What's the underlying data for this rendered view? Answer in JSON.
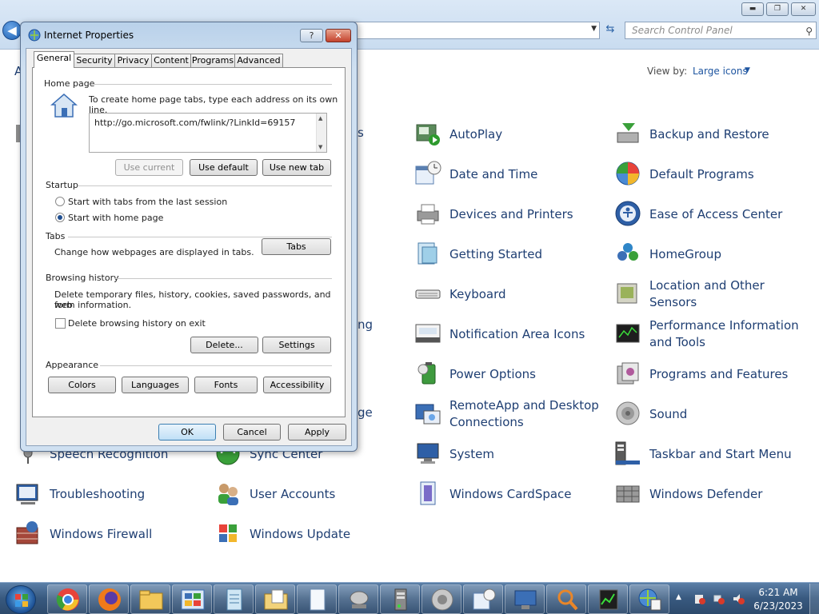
{
  "control_panel": {
    "search_placeholder": "Search Control Panel",
    "adjust_heading": "A",
    "view_by_label": "View by:",
    "view_by_value": "Large icons",
    "items": [
      {
        "label": "AutoPlay",
        "icon": "autoplay-icon"
      },
      {
        "label": "Backup and Restore",
        "icon": "backup-icon"
      },
      {
        "label": "Date and Time",
        "icon": "calendar-clock-icon"
      },
      {
        "label": "Default Programs",
        "icon": "default-programs-icon"
      },
      {
        "label": "Devices and Printers",
        "icon": "printer-icon"
      },
      {
        "label": "Ease of Access Center",
        "icon": "ease-of-access-icon"
      },
      {
        "label": "Getting Started",
        "icon": "getting-started-icon"
      },
      {
        "label": "HomeGroup",
        "icon": "homegroup-icon"
      },
      {
        "label": "Keyboard",
        "icon": "keyboard-icon"
      },
      {
        "label": "Location and Other Sensors",
        "icon": "location-sensors-icon"
      },
      {
        "label": "Notification Area Icons",
        "icon": "notification-area-icon"
      },
      {
        "label": "Performance Information and Tools",
        "icon": "performance-icon"
      },
      {
        "label": "Power Options",
        "icon": "power-icon"
      },
      {
        "label": "Programs and Features",
        "icon": "programs-features-icon"
      },
      {
        "label": "RemoteApp and Desktop Connections",
        "icon": "remoteapp-icon"
      },
      {
        "label": "Sound",
        "icon": "speaker-icon"
      },
      {
        "label": "Speech Recognition",
        "icon": "microphone-icon"
      },
      {
        "label": "Sync Center",
        "icon": "sync-icon"
      },
      {
        "label": "System",
        "icon": "system-icon"
      },
      {
        "label": "Taskbar and Start Menu",
        "icon": "taskbar-icon"
      },
      {
        "label": "Troubleshooting",
        "icon": "troubleshooting-icon"
      },
      {
        "label": "User Accounts",
        "icon": "user-accounts-icon"
      },
      {
        "label": "Windows CardSpace",
        "icon": "cardspace-icon"
      },
      {
        "label": "Windows Defender",
        "icon": "defender-icon"
      },
      {
        "label": "Windows Firewall",
        "icon": "firewall-icon"
      },
      {
        "label": "Windows Update",
        "icon": "windows-update-icon"
      }
    ],
    "partial_labels": [
      "s",
      "ng",
      "ge"
    ]
  },
  "dialog": {
    "title": "Internet Properties",
    "help_label": "?",
    "close_label": "✕",
    "tabs": [
      "General",
      "Security",
      "Privacy",
      "Content",
      "Programs",
      "Advanced"
    ],
    "active_tab": "General",
    "home_page": {
      "title": "Home page",
      "instruction": "To create home page tabs, type each address on its own line.",
      "url": "http://go.microsoft.com/fwlink/?LinkId=69157",
      "use_current": "Use current",
      "use_default": "Use default",
      "use_new_tab": "Use new tab"
    },
    "startup": {
      "title": "Startup",
      "option_last_session": "Start with tabs from the last session",
      "option_home_page": "Start with home page",
      "selected": "Start with home page"
    },
    "tabs_group": {
      "title": "Tabs",
      "description": "Change how webpages are displayed in tabs.",
      "button": "Tabs"
    },
    "history": {
      "title": "Browsing history",
      "description_line1": "Delete temporary files, history, cookies, saved passwords, and web",
      "description_line2": "form information.",
      "delete_on_exit": "Delete browsing history on exit",
      "delete_on_exit_checked": false,
      "delete_button": "Delete...",
      "settings_button": "Settings"
    },
    "appearance": {
      "title": "Appearance",
      "colors": "Colors",
      "languages": "Languages",
      "fonts": "Fonts",
      "accessibility": "Accessibility"
    },
    "ok": "OK",
    "cancel": "Cancel",
    "apply": "Apply"
  },
  "taskbar": {
    "time": "6:21 AM",
    "date": "6/23/2023",
    "pinned": [
      "chrome-icon",
      "firefox-icon",
      "file-explorer-icon",
      "control-panel-icon",
      "notepad-icon",
      "folder-icon",
      "document-icon",
      "network-icon",
      "server-icon",
      "speaker-icon",
      "calendar-icon",
      "remote-desktop-icon",
      "search-icon",
      "task-manager-icon",
      "internet-options-icon"
    ]
  },
  "colors": {
    "link_blue": "#1e3e72",
    "accent": "#1e55a0"
  }
}
